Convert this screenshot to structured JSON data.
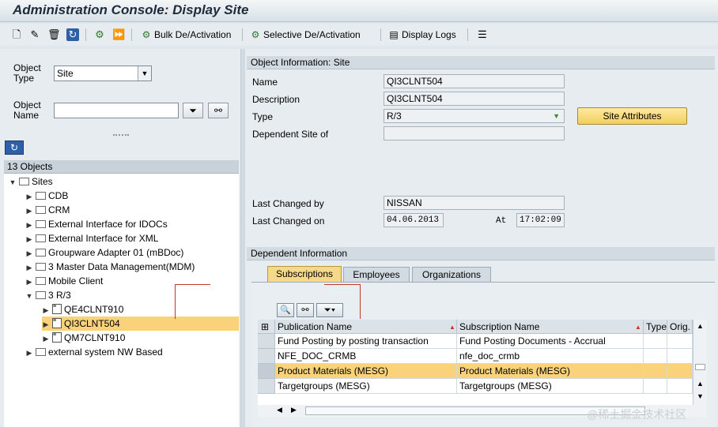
{
  "title": "Administration Console: Display Site",
  "toolbar": {
    "bulk_label": "Bulk De/Activation",
    "selective_label": "Selective De/Activation",
    "logs_label": "Display Logs"
  },
  "search": {
    "object_type_label": "Object\nType",
    "object_type_value": "Site",
    "object_name_label": "Object\nName",
    "object_name_value": ""
  },
  "tree": {
    "count": "13 Objects",
    "root": "Sites",
    "items": [
      "CDB",
      "CRM",
      "External Interface for IDOCs",
      "External Interface for XML",
      "Groupware Adapter 01 (mBDoc)",
      "3 Master Data Management(MDM)",
      "Mobile Client",
      "3 R/3",
      "external system NW Based"
    ],
    "children": [
      "QE4CLNT910",
      "QI3CLNT504",
      "QM7CLNT910"
    ]
  },
  "object_info": {
    "title": "Object Information: Site",
    "name_label": "Name",
    "name_value": "QI3CLNT504",
    "desc_label": "Description",
    "desc_value": "QI3CLNT504",
    "type_label": "Type",
    "type_value": "R/3",
    "dependent_label": "Dependent Site of",
    "dependent_value": "",
    "changed_by_label": "Last Changed by",
    "changed_by_value": "NISSAN",
    "changed_on_label": "Last Changed on",
    "changed_on_value": "04.06.2013",
    "at_label": "At",
    "at_value": "17:02:09",
    "site_attr_button": "Site Attributes"
  },
  "dependent": {
    "title": "Dependent Information",
    "tabs": [
      "Subscriptions",
      "Employees",
      "Organizations"
    ],
    "columns": [
      "Publication Name",
      "Subscription Name",
      "Type",
      "Orig."
    ],
    "rows": [
      [
        "Fund Posting by posting transaction",
        "Fund Posting Documents - Accrual"
      ],
      [
        "NFE_DOC_CRMB",
        "nfe_doc_crmb"
      ],
      [
        "Product Materials (MESG)",
        "Product Materials (MESG)"
      ],
      [
        "Targetgroups (MESG)",
        "Targetgroups (MESG)"
      ]
    ]
  },
  "watermark": "@稀土掘金技术社区",
  "colors": {
    "selection": "#f9d27a",
    "button_yellow": "#f2cf5a"
  }
}
